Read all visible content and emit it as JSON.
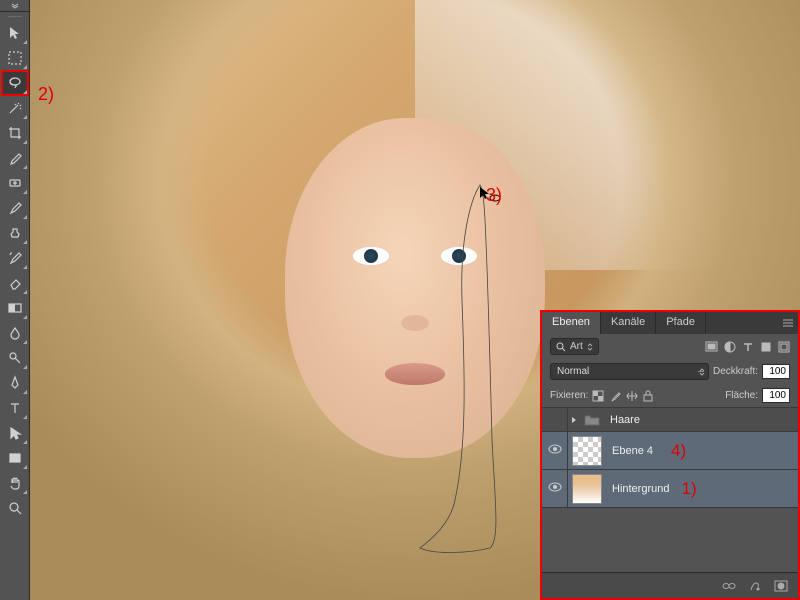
{
  "tools": [
    {
      "name": "move-tool"
    },
    {
      "name": "marquee-tool"
    },
    {
      "name": "lasso-tool",
      "highlighted": true
    },
    {
      "name": "magic-wand-tool"
    },
    {
      "name": "crop-tool"
    },
    {
      "name": "eyedropper-tool"
    },
    {
      "name": "healing-brush-tool"
    },
    {
      "name": "brush-tool"
    },
    {
      "name": "clone-stamp-tool"
    },
    {
      "name": "history-brush-tool"
    },
    {
      "name": "eraser-tool"
    },
    {
      "name": "gradient-tool"
    },
    {
      "name": "blur-tool"
    },
    {
      "name": "dodge-tool"
    },
    {
      "name": "pen-tool"
    },
    {
      "name": "type-tool"
    },
    {
      "name": "path-selection-tool"
    },
    {
      "name": "rectangle-tool"
    },
    {
      "name": "hand-tool"
    },
    {
      "name": "zoom-tool"
    }
  ],
  "annotations": {
    "a1": "1)",
    "a2": "2)",
    "a3": "3)",
    "a4": "4)"
  },
  "panel": {
    "tabs": {
      "ebenen": "Ebenen",
      "kanaele": "Kanäle",
      "pfade": "Pfade"
    },
    "filter": {
      "label": "Art"
    },
    "blend": {
      "mode": "Normal",
      "opacity_label": "Deckkraft:",
      "opacity_value": "100"
    },
    "lock": {
      "label": "Fixieren:",
      "fill_label": "Fläche:",
      "fill_value": "100"
    },
    "layers": {
      "group": "Haare",
      "layer1": "Ebene 4",
      "layer2": "Hintergrund"
    }
  }
}
